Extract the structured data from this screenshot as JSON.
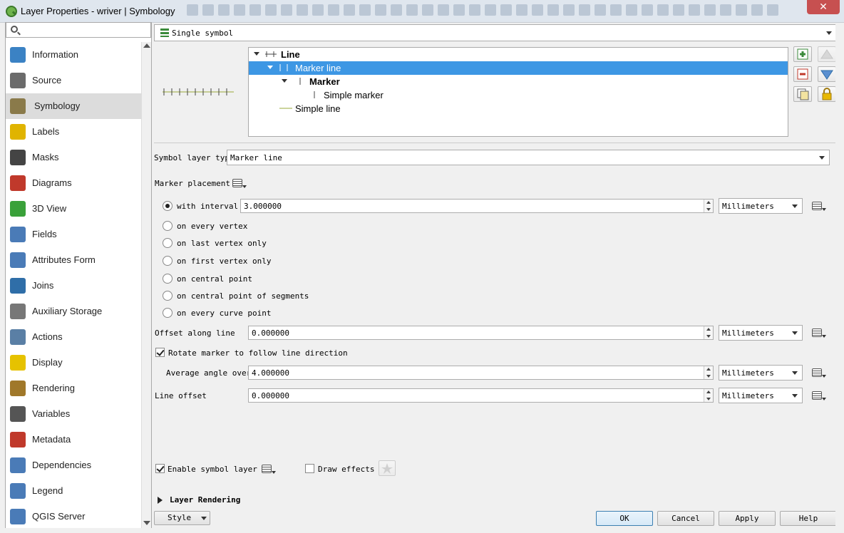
{
  "window": {
    "title": "Layer Properties - wriver | Symbology",
    "close_label": "✕"
  },
  "sidebar": {
    "search_placeholder": "",
    "items": [
      {
        "label": "Information",
        "icon": "info-icon",
        "color": "#3b82c4"
      },
      {
        "label": "Source",
        "icon": "wrench-gear-icon",
        "color": "#6b6b6b"
      },
      {
        "label": "Symbology",
        "icon": "paintbrush-icon",
        "color": "#8a7a4a",
        "selected": true
      },
      {
        "label": "Labels",
        "icon": "abc-label-icon",
        "color": "#e0b400"
      },
      {
        "label": "Masks",
        "icon": "abc-mask-icon",
        "color": "#444444"
      },
      {
        "label": "Diagrams",
        "icon": "diagram-icon",
        "color": "#c0392b"
      },
      {
        "label": "3D View",
        "icon": "cube-icon",
        "color": "#3aa13a"
      },
      {
        "label": "Fields",
        "icon": "table-fields-icon",
        "color": "#4a7bb7"
      },
      {
        "label": "Attributes Form",
        "icon": "form-icon",
        "color": "#4a7bb7"
      },
      {
        "label": "Joins",
        "icon": "joins-icon",
        "color": "#2f6ea8"
      },
      {
        "label": "Auxiliary Storage",
        "icon": "database-icon",
        "color": "#777777"
      },
      {
        "label": "Actions",
        "icon": "actions-gear-icon",
        "color": "#5a7fa5"
      },
      {
        "label": "Display",
        "icon": "speech-bubble-icon",
        "color": "#e6c200"
      },
      {
        "label": "Rendering",
        "icon": "brush-icon",
        "color": "#a0782a"
      },
      {
        "label": "Variables",
        "icon": "epsilon-icon",
        "color": "#555555"
      },
      {
        "label": "Metadata",
        "icon": "metadata-icon",
        "color": "#c0392b"
      },
      {
        "label": "Dependencies",
        "icon": "dependencies-icon",
        "color": "#4a7bb7"
      },
      {
        "label": "Legend",
        "icon": "legend-icon",
        "color": "#4a7bb7"
      },
      {
        "label": "QGIS Server",
        "icon": "server-icon",
        "color": "#4a7bb7"
      }
    ]
  },
  "renderer": {
    "value": "Single symbol"
  },
  "symbol_tree": {
    "rows": [
      {
        "label": "Line",
        "bold": true
      },
      {
        "label": "Marker line",
        "selected": true
      },
      {
        "label": "Marker",
        "bold": true
      },
      {
        "label": "Simple marker"
      },
      {
        "label": "Simple line"
      }
    ]
  },
  "symbol_layer": {
    "type_label": "Symbol layer type",
    "type_value": "Marker line",
    "placement_label": "Marker placement",
    "placement_options": [
      {
        "label": "with interval",
        "checked": true
      },
      {
        "label": "on every vertex"
      },
      {
        "label": "on last vertex only"
      },
      {
        "label": "on first vertex only"
      },
      {
        "label": "on central point"
      },
      {
        "label": "on central point of segments"
      },
      {
        "label": "on every curve point"
      }
    ],
    "interval_value": "3.000000",
    "interval_unit": "Millimeters",
    "offset_along_label": "Offset along line",
    "offset_along_value": "0.000000",
    "offset_along_unit": "Millimeters",
    "rotate_label": "Rotate marker to follow line direction",
    "avg_angle_label": "Average angle over",
    "avg_angle_value": "4.000000",
    "avg_angle_unit": "Millimeters",
    "line_offset_label": "Line offset",
    "line_offset_value": "0.000000",
    "line_offset_unit": "Millimeters",
    "enable_label": "Enable symbol layer",
    "draw_effects_label": "Draw effects",
    "layer_rendering_label": "Layer Rendering"
  },
  "footer": {
    "style_label": "Style",
    "ok_label": "OK",
    "cancel_label": "Cancel",
    "apply_label": "Apply",
    "help_label": "Help"
  },
  "colors": {
    "selection": "#3d97e4",
    "line_preview": "#9aa83a"
  }
}
